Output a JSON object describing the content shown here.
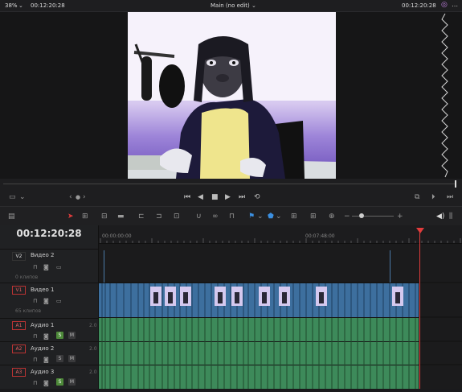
{
  "topbar": {
    "zoom": "38%",
    "source_timecode": "00:12:20:28",
    "title": "Main (no edit)",
    "record_timecode": "00:12:20:28"
  },
  "timeline": {
    "current_timecode": "00:12:20:28",
    "ruler_start": "00:00:00:00",
    "ruler_mark": "00:07:48:00",
    "playhead_color": "#e23c3c"
  },
  "tracks": [
    {
      "tag": "V2",
      "name": "Видео 2",
      "info": "0 клипов",
      "type": "video"
    },
    {
      "tag": "V1",
      "name": "Видео 1",
      "info": "65 клипов",
      "type": "video"
    },
    {
      "tag": "A1",
      "name": "Аудио 1",
      "level": "2.0",
      "type": "audio"
    },
    {
      "tag": "A2",
      "name": "Аудио 2",
      "level": "2.0",
      "type": "audio"
    },
    {
      "tag": "A3",
      "name": "Аудио 3",
      "level": "2.0",
      "type": "audio"
    }
  ],
  "audio_buttons": {
    "solo": "S",
    "mute": "M"
  },
  "colors": {
    "video_clip": "#3d6f9e",
    "audio_clip": "#3d8a5a",
    "accent_red": "#e23c3c"
  },
  "icons": {
    "transport": [
      "go-start-icon",
      "step-back-icon",
      "stop-icon",
      "play-icon",
      "step-forward-icon",
      "loop-icon"
    ],
    "toolbar": [
      "timeline-view-icon",
      "selection-tool-icon",
      "trim-tool-icon",
      "dynamic-trim-icon",
      "blade-tool-icon",
      "insert-icon",
      "overwrite-icon",
      "replace-icon",
      "snap-icon",
      "link-icon",
      "lock-icon",
      "flag-icon",
      "marker-icon",
      "zoom-full-icon",
      "zoom-detail-icon",
      "zoom-custom-icon",
      "zoom-slider",
      "volume-icon"
    ]
  }
}
